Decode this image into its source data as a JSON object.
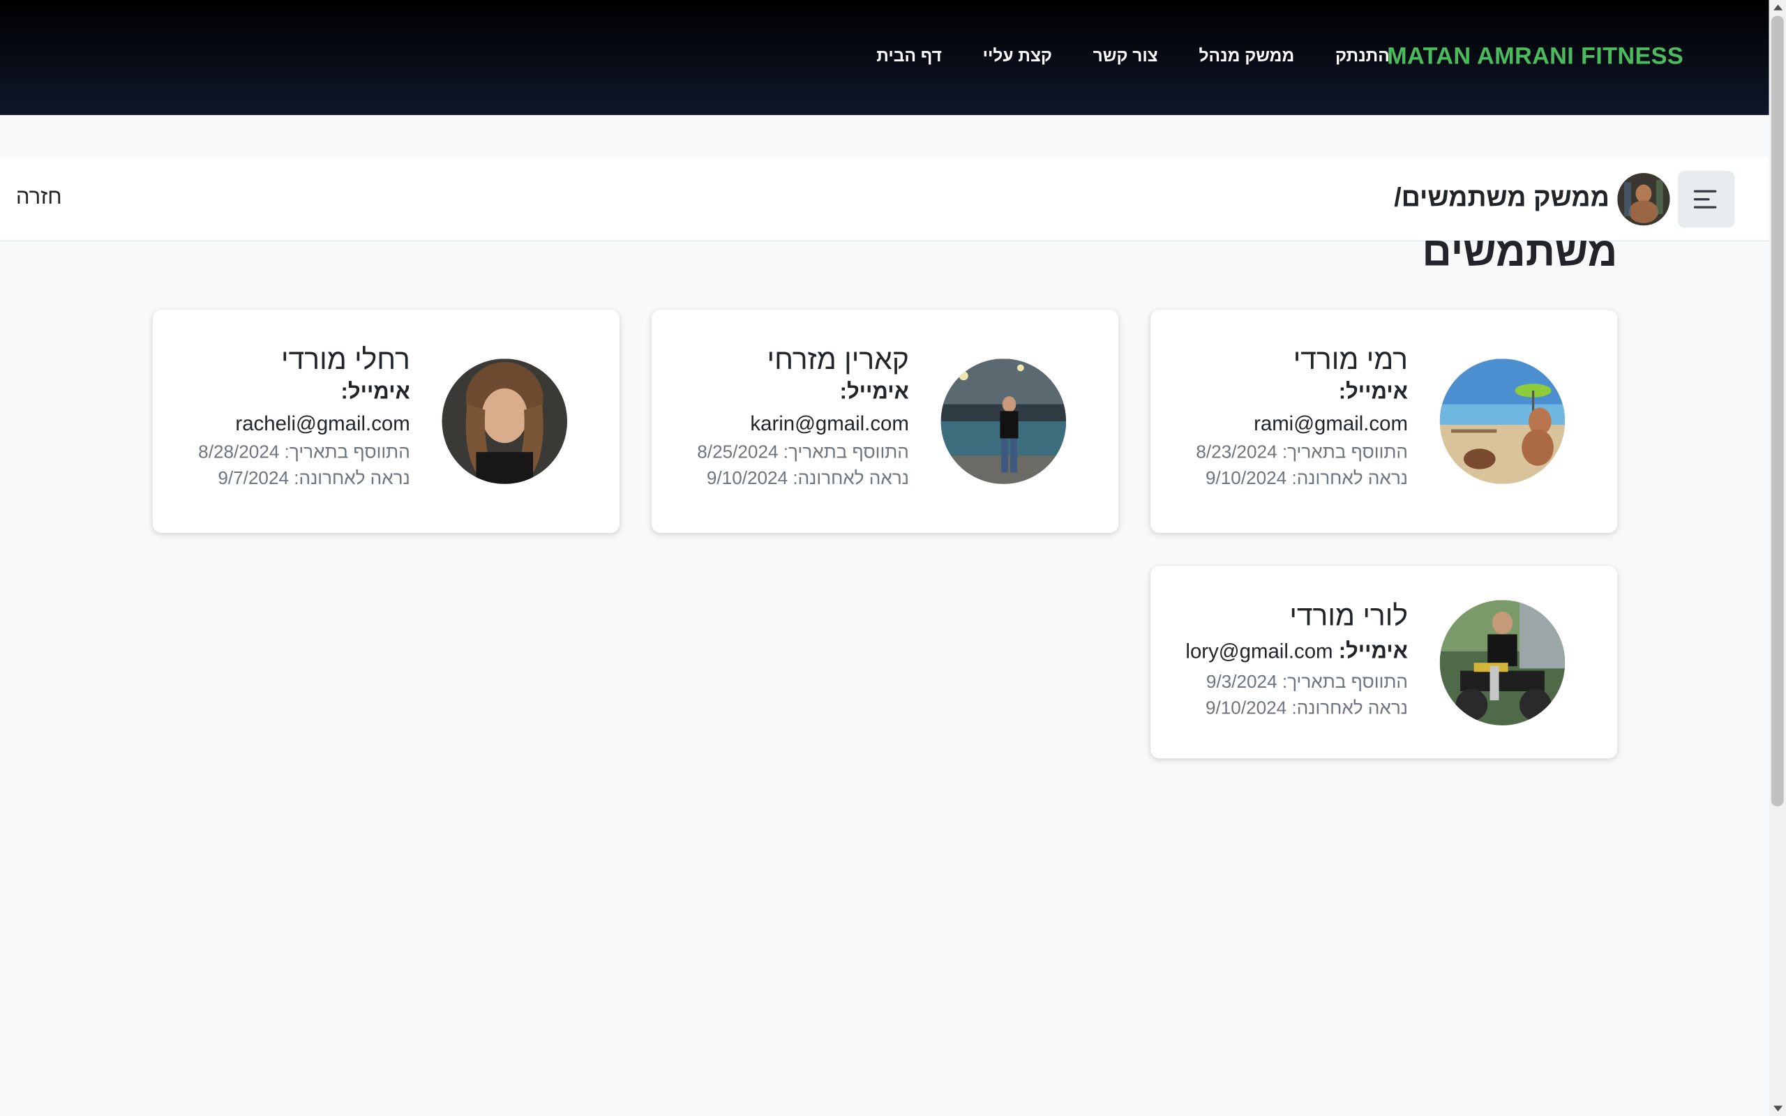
{
  "navbar": {
    "brand": "MATAN AMRANI FITNESS",
    "links": [
      "דף הבית",
      "קצת עליי",
      "צור קשר",
      "ממשק מנהל",
      "התנתק"
    ],
    "background": "#0f1729",
    "brand_color": "#4cbb5e"
  },
  "subheader": {
    "breadcrumb": "ממשק משתמשים/",
    "back": "חזרה",
    "menu_icon": "hamburger-icon"
  },
  "page": {
    "title": "משתמשים"
  },
  "users": [
    {
      "name": "רמי מורדי",
      "email_label": "אימייל:",
      "email": "rami@gmail.com",
      "added": "התווסף בתאריך: 8/23/2024",
      "last_seen": "נראה לאחרונה: 9/10/2024"
    },
    {
      "name": "קארין מזרחי",
      "email_label": "אימייל:",
      "email": "karin@gmail.com",
      "added": "התווסף בתאריך: 8/25/2024",
      "last_seen": "נראה לאחרונה: 9/10/2024"
    },
    {
      "name": "רחלי מורדי",
      "email_label": "אימייל:",
      "email": "racheli@gmail.com",
      "added": "התווסף בתאריך: 8/28/2024",
      "last_seen": "נראה לאחרונה: 9/7/2024"
    },
    {
      "name": "לורי מורדי",
      "email_label": "אימייל:",
      "email": "lory@gmail.com",
      "added": "התווסף בתאריך: 9/3/2024",
      "last_seen": "נראה לאחרונה: 9/10/2024"
    }
  ]
}
